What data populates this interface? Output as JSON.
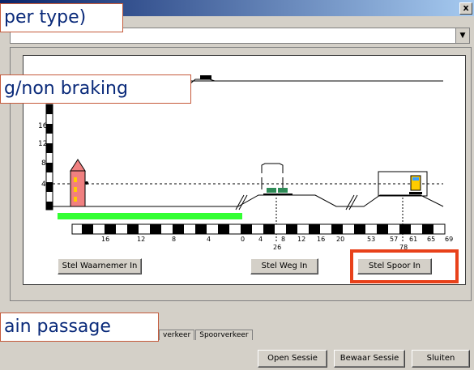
{
  "window": {
    "close_glyph": "x"
  },
  "callouts": {
    "top": "per type)",
    "middle": "g/non braking",
    "bottom": "ain passage"
  },
  "chart": {
    "y_ticks": [
      "16",
      "12",
      "8",
      "4"
    ],
    "scale_left": [
      "16",
      "12",
      "8",
      "4",
      "0"
    ],
    "scale_mid": [
      "4",
      "8",
      "12",
      "16",
      "20"
    ],
    "scale_right": [
      "53",
      "57",
      "61",
      "65",
      "69"
    ],
    "marker_left": "26",
    "marker_right": "78"
  },
  "buttons": {
    "stel_waarnemer": "Stel Waarnemer In",
    "stel_weg": "Stel Weg In",
    "stel_spoor": "Stel Spoor In",
    "open_sessie": "Open Sessie",
    "bewaar_sessie": "Bewaar Sessie",
    "sluiten": "Sluiten"
  },
  "tabs": [
    "verkeer",
    "Spoorverkeer"
  ],
  "colors": {
    "accent_red": "#e8411a",
    "callout_border": "#c55a3b",
    "callout_text": "#0a2a7a",
    "green_bar": "#33ff33"
  }
}
